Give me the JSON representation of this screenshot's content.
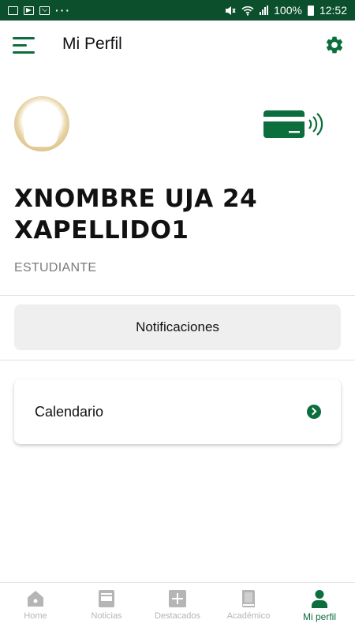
{
  "status_bar": {
    "battery": "100%",
    "time": "12:52"
  },
  "header": {
    "title": "Mi Perfil",
    "menu_icon": "hamburger-menu-icon",
    "settings_icon": "gear-icon"
  },
  "profile": {
    "name_line1": "XNOMBRE UJA 24",
    "name_line2": "XAPELLIDO1",
    "role": "ESTUDIANTE",
    "card_icon": "contactless-card-icon"
  },
  "actions": {
    "notifications_label": "Notificaciones",
    "calendar_label": "Calendario"
  },
  "bottom_nav": {
    "items": [
      {
        "label": "Home",
        "icon": "home-icon",
        "active": false
      },
      {
        "label": "Noticias",
        "icon": "news-icon",
        "active": false
      },
      {
        "label": "Destacados",
        "icon": "plus-box-icon",
        "active": false
      },
      {
        "label": "Académico",
        "icon": "book-icon",
        "active": false
      },
      {
        "label": "Mi perfil",
        "icon": "person-icon",
        "active": true
      }
    ]
  },
  "colors": {
    "brand_green": "#0b6e3c",
    "status_bar": "#0b4f2c",
    "inactive": "#b5b5b5"
  }
}
